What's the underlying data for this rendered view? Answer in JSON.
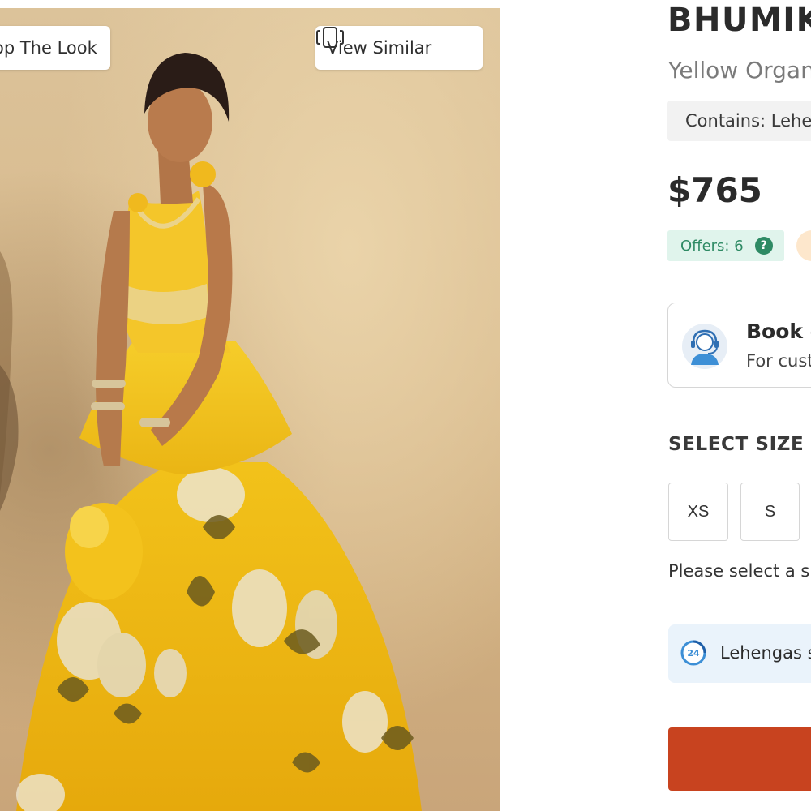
{
  "image_overlay": {
    "shop_label": "op The Look",
    "view_similar_label": "View Similar"
  },
  "product": {
    "brand": "BHUMIK",
    "subtitle": "Yellow Organ",
    "contains": "Contains: Lehe",
    "price": "$765"
  },
  "offers": {
    "label": "Offers: 6",
    "help_glyph": "?"
  },
  "book_card": {
    "title": "Book c",
    "subtitle": "For cust"
  },
  "size_selector": {
    "heading": "SELECT SIZE",
    "options": [
      "XS",
      "S"
    ],
    "message": "Please select a siz"
  },
  "shipping_banner": {
    "text": "Lehengas s"
  },
  "colors": {
    "offers_green": "#2e8a64",
    "offers_bg": "#e0f4ec",
    "cta_red": "#c8431f",
    "banner_bg": "#eaf3fb",
    "icon_blue": "#3d8fd6"
  },
  "icons": {
    "view_similar": "phone-stack-icon",
    "offers_help": "question-icon",
    "book_card": "support-agent-icon",
    "shipping": "clock-24-icon"
  }
}
